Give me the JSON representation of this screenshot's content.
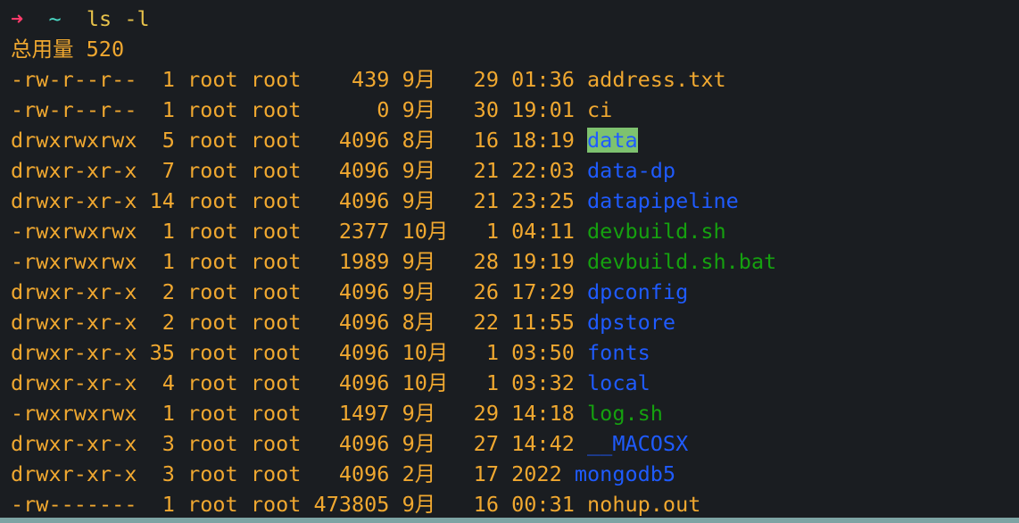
{
  "terminal": {
    "prompt": {
      "arrow": "➜",
      "dir": "~",
      "command": "ls -l"
    },
    "total_line": "总用量 520",
    "rows": [
      {
        "meta": "-rw-r--r--  1 root root    439 9月   29 01:36 ",
        "name": "address.txt",
        "kind": "file"
      },
      {
        "meta": "-rw-r--r--  1 root root      0 9月   30 19:01 ",
        "name": "ci",
        "kind": "file"
      },
      {
        "meta": "drwxrwxrwx  5 root root   4096 8月   16 18:19 ",
        "name": "data",
        "kind": "highlight"
      },
      {
        "meta": "drwxr-xr-x  7 root root   4096 9月   21 22:03 ",
        "name": "data-dp",
        "kind": "dir"
      },
      {
        "meta": "drwxr-xr-x 14 root root   4096 9月   21 23:25 ",
        "name": "datapipeline",
        "kind": "dir"
      },
      {
        "meta": "-rwxrwxrwx  1 root root   2377 10月   1 04:11 ",
        "name": "devbuild.sh",
        "kind": "exec"
      },
      {
        "meta": "-rwxrwxrwx  1 root root   1989 9月   28 19:19 ",
        "name": "devbuild.sh.bat",
        "kind": "exec"
      },
      {
        "meta": "drwxr-xr-x  2 root root   4096 9月   26 17:29 ",
        "name": "dpconfig",
        "kind": "dir"
      },
      {
        "meta": "drwxr-xr-x  2 root root   4096 8月   22 11:55 ",
        "name": "dpstore",
        "kind": "dir"
      },
      {
        "meta": "drwxr-xr-x 35 root root   4096 10月   1 03:50 ",
        "name": "fonts",
        "kind": "dir"
      },
      {
        "meta": "drwxr-xr-x  4 root root   4096 10月   1 03:32 ",
        "name": "local",
        "kind": "dir"
      },
      {
        "meta": "-rwxrwxrwx  1 root root   1497 9月   29 14:18 ",
        "name": "log.sh",
        "kind": "exec"
      },
      {
        "meta": "drwxr-xr-x  3 root root   4096 9月   27 14:42 ",
        "name": "__MACOSX",
        "kind": "dir"
      },
      {
        "meta": "drwxr-xr-x  3 root root   4096 2月   17 2022 ",
        "name": "mongodb5",
        "kind": "dir"
      },
      {
        "meta": "-rw-------  1 root root 473805 9月   16 00:31 ",
        "name": "nohup.out",
        "kind": "file"
      }
    ]
  }
}
